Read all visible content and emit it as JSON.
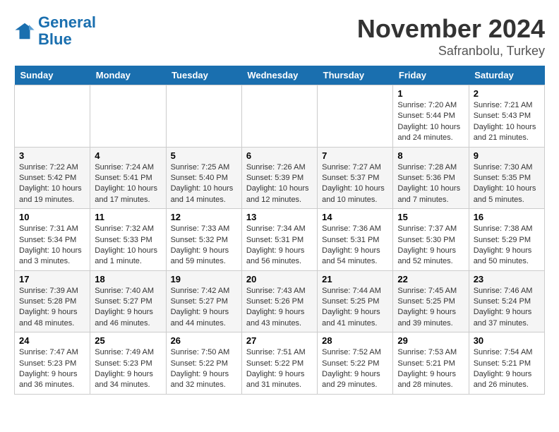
{
  "logo": {
    "line1": "General",
    "line2": "Blue"
  },
  "header": {
    "month": "November 2024",
    "location": "Safranbolu, Turkey"
  },
  "weekdays": [
    "Sunday",
    "Monday",
    "Tuesday",
    "Wednesday",
    "Thursday",
    "Friday",
    "Saturday"
  ],
  "weeks": [
    [
      {
        "day": "",
        "info": ""
      },
      {
        "day": "",
        "info": ""
      },
      {
        "day": "",
        "info": ""
      },
      {
        "day": "",
        "info": ""
      },
      {
        "day": "",
        "info": ""
      },
      {
        "day": "1",
        "info": "Sunrise: 7:20 AM\nSunset: 5:44 PM\nDaylight: 10 hours and 24 minutes."
      },
      {
        "day": "2",
        "info": "Sunrise: 7:21 AM\nSunset: 5:43 PM\nDaylight: 10 hours and 21 minutes."
      }
    ],
    [
      {
        "day": "3",
        "info": "Sunrise: 7:22 AM\nSunset: 5:42 PM\nDaylight: 10 hours and 19 minutes."
      },
      {
        "day": "4",
        "info": "Sunrise: 7:24 AM\nSunset: 5:41 PM\nDaylight: 10 hours and 17 minutes."
      },
      {
        "day": "5",
        "info": "Sunrise: 7:25 AM\nSunset: 5:40 PM\nDaylight: 10 hours and 14 minutes."
      },
      {
        "day": "6",
        "info": "Sunrise: 7:26 AM\nSunset: 5:39 PM\nDaylight: 10 hours and 12 minutes."
      },
      {
        "day": "7",
        "info": "Sunrise: 7:27 AM\nSunset: 5:37 PM\nDaylight: 10 hours and 10 minutes."
      },
      {
        "day": "8",
        "info": "Sunrise: 7:28 AM\nSunset: 5:36 PM\nDaylight: 10 hours and 7 minutes."
      },
      {
        "day": "9",
        "info": "Sunrise: 7:30 AM\nSunset: 5:35 PM\nDaylight: 10 hours and 5 minutes."
      }
    ],
    [
      {
        "day": "10",
        "info": "Sunrise: 7:31 AM\nSunset: 5:34 PM\nDaylight: 10 hours and 3 minutes."
      },
      {
        "day": "11",
        "info": "Sunrise: 7:32 AM\nSunset: 5:33 PM\nDaylight: 10 hours and 1 minute."
      },
      {
        "day": "12",
        "info": "Sunrise: 7:33 AM\nSunset: 5:32 PM\nDaylight: 9 hours and 59 minutes."
      },
      {
        "day": "13",
        "info": "Sunrise: 7:34 AM\nSunset: 5:31 PM\nDaylight: 9 hours and 56 minutes."
      },
      {
        "day": "14",
        "info": "Sunrise: 7:36 AM\nSunset: 5:31 PM\nDaylight: 9 hours and 54 minutes."
      },
      {
        "day": "15",
        "info": "Sunrise: 7:37 AM\nSunset: 5:30 PM\nDaylight: 9 hours and 52 minutes."
      },
      {
        "day": "16",
        "info": "Sunrise: 7:38 AM\nSunset: 5:29 PM\nDaylight: 9 hours and 50 minutes."
      }
    ],
    [
      {
        "day": "17",
        "info": "Sunrise: 7:39 AM\nSunset: 5:28 PM\nDaylight: 9 hours and 48 minutes."
      },
      {
        "day": "18",
        "info": "Sunrise: 7:40 AM\nSunset: 5:27 PM\nDaylight: 9 hours and 46 minutes."
      },
      {
        "day": "19",
        "info": "Sunrise: 7:42 AM\nSunset: 5:27 PM\nDaylight: 9 hours and 44 minutes."
      },
      {
        "day": "20",
        "info": "Sunrise: 7:43 AM\nSunset: 5:26 PM\nDaylight: 9 hours and 43 minutes."
      },
      {
        "day": "21",
        "info": "Sunrise: 7:44 AM\nSunset: 5:25 PM\nDaylight: 9 hours and 41 minutes."
      },
      {
        "day": "22",
        "info": "Sunrise: 7:45 AM\nSunset: 5:25 PM\nDaylight: 9 hours and 39 minutes."
      },
      {
        "day": "23",
        "info": "Sunrise: 7:46 AM\nSunset: 5:24 PM\nDaylight: 9 hours and 37 minutes."
      }
    ],
    [
      {
        "day": "24",
        "info": "Sunrise: 7:47 AM\nSunset: 5:23 PM\nDaylight: 9 hours and 36 minutes."
      },
      {
        "day": "25",
        "info": "Sunrise: 7:49 AM\nSunset: 5:23 PM\nDaylight: 9 hours and 34 minutes."
      },
      {
        "day": "26",
        "info": "Sunrise: 7:50 AM\nSunset: 5:22 PM\nDaylight: 9 hours and 32 minutes."
      },
      {
        "day": "27",
        "info": "Sunrise: 7:51 AM\nSunset: 5:22 PM\nDaylight: 9 hours and 31 minutes."
      },
      {
        "day": "28",
        "info": "Sunrise: 7:52 AM\nSunset: 5:22 PM\nDaylight: 9 hours and 29 minutes."
      },
      {
        "day": "29",
        "info": "Sunrise: 7:53 AM\nSunset: 5:21 PM\nDaylight: 9 hours and 28 minutes."
      },
      {
        "day": "30",
        "info": "Sunrise: 7:54 AM\nSunset: 5:21 PM\nDaylight: 9 hours and 26 minutes."
      }
    ]
  ]
}
